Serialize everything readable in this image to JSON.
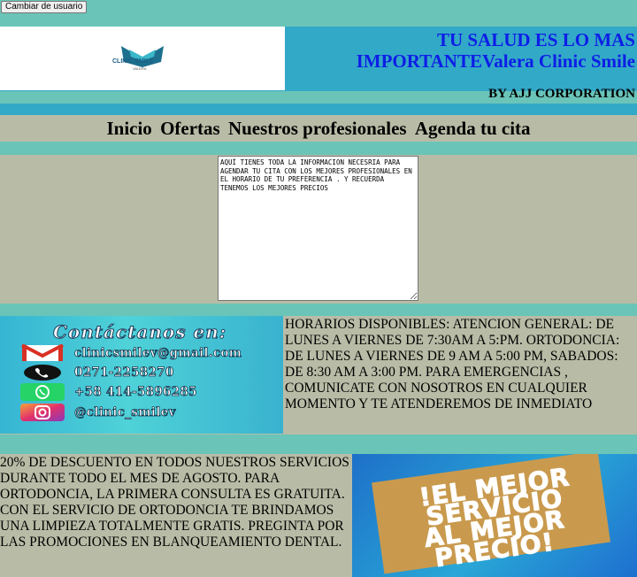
{
  "topbar": {
    "switch_user_label": "Cambiar de usuario"
  },
  "header": {
    "logo_text": "CLINIC SMILE",
    "logo_sub": "VALERA",
    "slogan": "TU SALUD ES LO MAS IMPORTANTEValera Clinic Smile",
    "byline": "BY AJJ CORPORATION",
    "slogan_color": "#0d1ee6"
  },
  "nav": {
    "items": [
      {
        "label": "Inicio"
      },
      {
        "label": "Ofertas"
      },
      {
        "label": "Nuestros profesionales"
      },
      {
        "label": "Agenda tu cita"
      }
    ]
  },
  "notes": {
    "text": "AQUÍ TIENES TODA LA INFORMACION NECESRIA PARA AGENDAR TU CITA CON LOS MEJORES PROFESIONALES EN EL HORARIO DE TU PREFERENCIA . Y RECUERDA TENEMOS LOS MEJORES PRECIOS"
  },
  "contact": {
    "title": "Contáctanos en:",
    "email": "clinicsmilev@gmail.com",
    "phone": "0271-2258270",
    "whatsapp": "+58 414-5896285",
    "instagram": "@clinic_smilev"
  },
  "hours": {
    "text": "HORARIOS DISPONIBLES: ATENCION GENERAL: DE LUNES A VIERNES DE 7:30AM A 5:PM. ORTODONCIA: DE LUNES A VIERNES DE 9 AM A 5:00 PM, SABADOS: DE 8:30 AM A 3:00 PM. PARA EMERGENCIAS , COMUNICATE CON NOSOTROS EN CUALQUIER MOMENTO Y TE ATENDEREMOS DE INMEDIATO"
  },
  "promo": {
    "text": "20% DE DESCUENTO EN TODOS NUESTROS SERVICIOS DURANTE TODO EL MES DE AGOSTO. PARA ORTODONCIA, LA PRIMERA CONSULTA ES GRATUITA. CON EL SERVICIO DE ORTODONCIA TE BRINDAMOS UNA LIMPIEZA TOTALMENTE GRATIS. PREGINTA POR LAS PROMOCIONES EN BLANQUEAMIENTO DENTAL.",
    "banner_lines": [
      "!EL MEJOR",
      "SERVICIO",
      "AL MEJOR",
      "PRECIO!"
    ]
  }
}
